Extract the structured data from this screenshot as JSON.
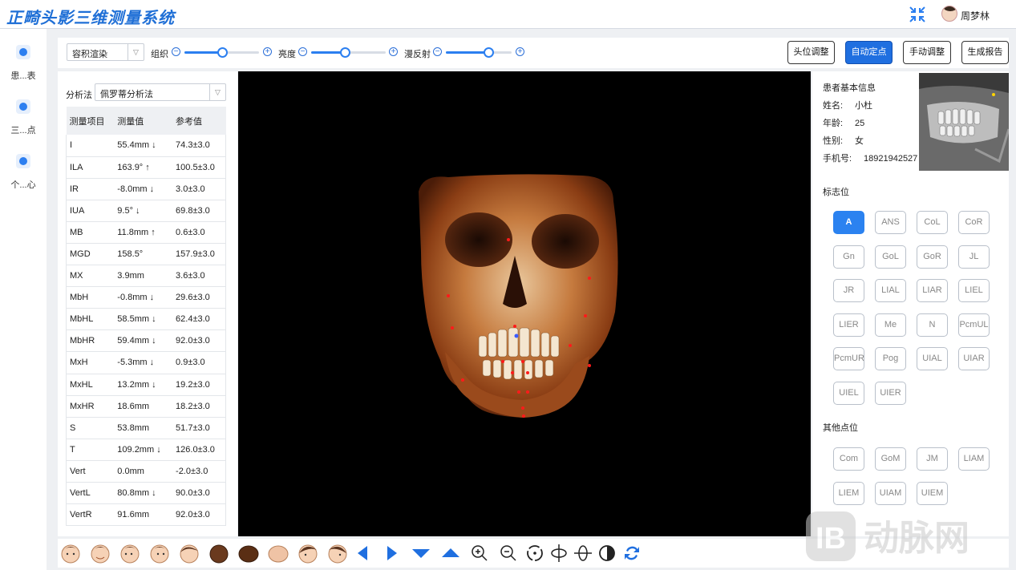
{
  "app": {
    "title": "正畸头影三维测量系统"
  },
  "user": {
    "name": "周梦林"
  },
  "nav": [
    {
      "label": "患...表",
      "icon": "patient-list-icon"
    },
    {
      "label": "三...点",
      "icon": "landmark-icon"
    },
    {
      "label": "个...心",
      "icon": "user-center-icon"
    }
  ],
  "toolbar": {
    "render_mode": "容积渲染",
    "sliders": [
      {
        "label": "组织",
        "value": 0.5
      },
      {
        "label": "亮度",
        "value": 0.45
      },
      {
        "label": "漫反射",
        "value": 0.65
      }
    ],
    "buttons": [
      "头位调整",
      "自动定点",
      "手动调整",
      "生成报告"
    ]
  },
  "measure": {
    "method_label": "分析法",
    "method_value": "佩罗蒂分析法",
    "headers": [
      "测量项目",
      "测量值",
      "参考值"
    ],
    "rows": [
      [
        "I",
        "55.4mm ↓",
        "74.3±3.0"
      ],
      [
        "ILA",
        "163.9° ↑",
        "100.5±3.0"
      ],
      [
        "IR",
        "-8.0mm ↓",
        "3.0±3.0"
      ],
      [
        "IUA",
        "9.5° ↓",
        "69.8±3.0"
      ],
      [
        "MB",
        "11.8mm ↑",
        "0.6±3.0"
      ],
      [
        "MGD",
        "158.5°",
        "157.9±3.0"
      ],
      [
        "MX",
        "3.9mm",
        "3.6±3.0"
      ],
      [
        "MbH",
        "-0.8mm ↓",
        "29.6±3.0"
      ],
      [
        "MbHL",
        "58.5mm ↓",
        "62.4±3.0"
      ],
      [
        "MbHR",
        "59.4mm ↓",
        "92.0±3.0"
      ],
      [
        "MxH",
        "-5.3mm ↓",
        "0.9±3.0"
      ],
      [
        "MxHL",
        "13.2mm ↓",
        "19.2±3.0"
      ],
      [
        "MxHR",
        "18.6mm",
        "18.2±3.0"
      ],
      [
        "S",
        "53.8mm",
        "51.7±3.0"
      ],
      [
        "T",
        "109.2mm ↓",
        "126.0±3.0"
      ],
      [
        "Vert",
        "0.0mm",
        "-2.0±3.0"
      ],
      [
        "VertL",
        "80.8mm ↓",
        "90.0±3.0"
      ],
      [
        "VertR",
        "91.6mm",
        "92.0±3.0"
      ]
    ]
  },
  "patient": {
    "title": "患者基本信息",
    "fields": [
      {
        "k": "姓名:",
        "v": "小杜"
      },
      {
        "k": "年龄:",
        "v": "25"
      },
      {
        "k": "性别:",
        "v": "女"
      },
      {
        "k": "手机号:",
        "v": "18921942527"
      }
    ]
  },
  "landmarks": {
    "title": "标志位",
    "active": "A",
    "items": [
      "A",
      "ANS",
      "CoL",
      "CoR",
      "Gn",
      "GoL",
      "GoR",
      "JL",
      "JR",
      "LIAL",
      "LIAR",
      "LIEL",
      "LIER",
      "Me",
      "N",
      "PcmUL",
      "PcmUR",
      "Pog",
      "UIAL",
      "UIAR",
      "UIEL",
      "UIER"
    ]
  },
  "other_points": {
    "title": "其他点位",
    "items": [
      "Com",
      "GoM",
      "JM",
      "LIAM",
      "LIEM",
      "UIAM",
      "UIEM"
    ]
  },
  "bottom_tools": [
    "face-front-icon",
    "face-smile-icon",
    "face-left-icon",
    "face-right-icon",
    "face-profile-icon",
    "head-back-icon",
    "head-top-icon",
    "head-bottom-icon",
    "face-tilt-left-icon",
    "face-tilt-right-icon",
    "arrow-left-icon",
    "arrow-right-icon",
    "arrow-down-icon",
    "arrow-up-icon",
    "zoom-in-icon",
    "zoom-out-icon",
    "rotate-icon",
    "rotate-x-icon",
    "rotate-y-icon",
    "contrast-icon",
    "reset-icon"
  ],
  "watermark": {
    "text": "动脉网"
  },
  "colors": {
    "accent": "#2b7ff0",
    "primary_btn": "#1f6fe0"
  }
}
